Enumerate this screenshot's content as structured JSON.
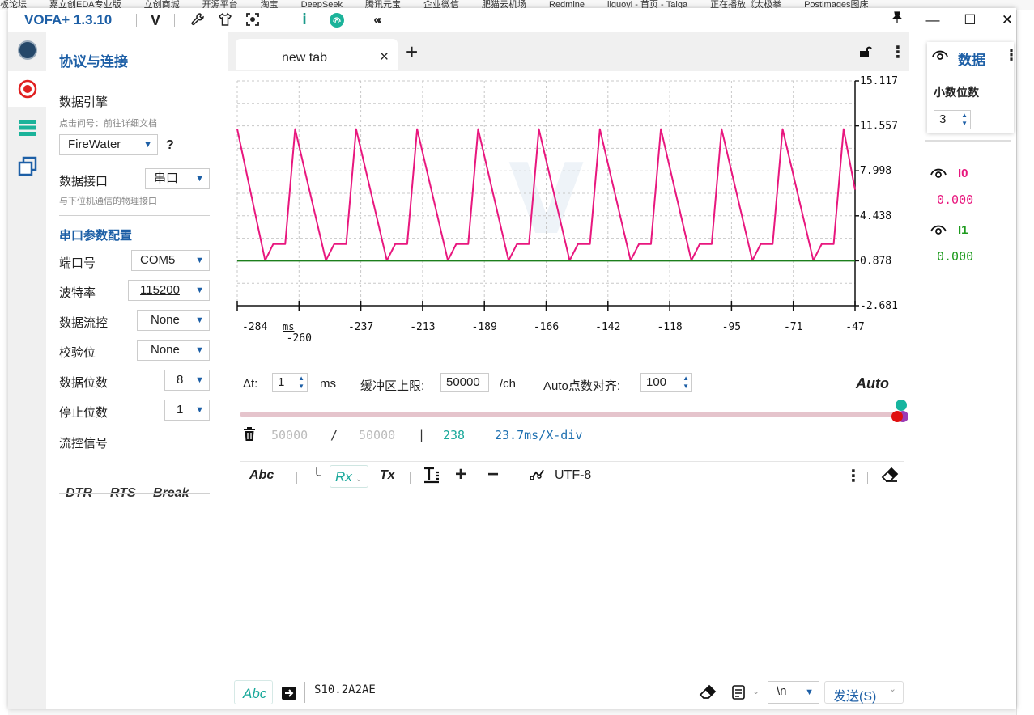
{
  "browser": {
    "bookmarks": [
      "板论坛",
      "嘉立创EDA专业版",
      "立创商城",
      "开源平台",
      "淘宝",
      "DeepSeek",
      "腾讯元宝",
      "企业微信",
      "肥猫云机场",
      "Redmine",
      "liguoyi - 首页 - Taiga",
      "正在播放《太极拳",
      "Postimages图床"
    ]
  },
  "app": {
    "title": "VOFA+ 1.3.10"
  },
  "rail": {
    "items": [
      "connection",
      "protocol",
      "data",
      "widgets"
    ]
  },
  "left": {
    "heading": "协议与连接",
    "engine_label": "数据引擎",
    "engine_hint": "点击问号：前往详细文档",
    "engine_value": "FireWater",
    "help": "?",
    "iface_label": "数据接口",
    "iface_value": "串口",
    "iface_hint": "与下位机通信的物理接口",
    "serial_heading": "串口参数配置",
    "port_label": "端口号",
    "port_value": "COM5",
    "baud_label": "波特率",
    "baud_value": "115200",
    "flow_label": "数据流控",
    "flow_value": "None",
    "parity_label": "校验位",
    "parity_value": "None",
    "databits_label": "数据位数",
    "databits_value": "8",
    "stopbits_label": "停止位数",
    "stopbits_value": "1",
    "signal_label": "流控信号",
    "dtr": "DTR",
    "rts": "RTS",
    "brk": "Break"
  },
  "tabs": {
    "tab1": "new tab",
    "close": "×",
    "add": "+"
  },
  "chart_data": {
    "type": "line",
    "xlabel": "ms",
    "x_ticks": [
      "-284",
      "-260",
      "-237",
      "-213",
      "-189",
      "-166",
      "-142",
      "-118",
      "-95",
      "-71",
      "-47"
    ],
    "y_ticks": [
      "15.117",
      "11.557",
      "7.998",
      "4.438",
      "0.878",
      "-2.681"
    ],
    "xlim": [
      -284,
      -47
    ],
    "ylim": [
      -2.681,
      15.117
    ],
    "series": [
      {
        "name": "I0",
        "color": "#e8177e",
        "x": [
          -284,
          -273.3,
          -270.2,
          -265.6,
          -261.8,
          -250.0,
          -246.8,
          -242.2,
          -238.4,
          -226.6,
          -223.4,
          -218.8,
          -215.0,
          -203.2,
          -200.0,
          -195.4,
          -191.6,
          -179.9,
          -176.7,
          -172.1,
          -168.3,
          -156.5,
          -153.3,
          -148.7,
          -144.9,
          -133.1,
          -129.9,
          -125.3,
          -121.5,
          -109.8,
          -106.6,
          -102.0,
          -98.2,
          -86.4,
          -83.2,
          -78.6,
          -74.8,
          -63.0,
          -59.8,
          -55.2,
          -51.4,
          -47
        ],
        "y": [
          11.3,
          0.9,
          2.2,
          2.2,
          11.3,
          0.9,
          2.2,
          2.2,
          11.3,
          0.9,
          2.2,
          2.2,
          11.3,
          0.9,
          2.2,
          2.2,
          11.3,
          0.9,
          2.2,
          2.2,
          11.3,
          0.9,
          2.2,
          2.2,
          11.3,
          0.9,
          2.2,
          2.2,
          11.3,
          0.9,
          2.2,
          2.2,
          11.3,
          0.9,
          2.2,
          2.2,
          11.3,
          0.9,
          2.2,
          2.2,
          11.3,
          6.5
        ]
      },
      {
        "name": "I1",
        "color": "#1d7f1d",
        "x": [
          -284,
          -47
        ],
        "y": [
          0.878,
          0.878
        ]
      }
    ]
  },
  "controls": {
    "dt_label": "Δt:",
    "dt_value": "1",
    "dt_unit": "ms",
    "buffer_label": "缓冲区上限:",
    "buffer_value": "50000",
    "buffer_unit": "/ch",
    "auto_align_label": "Auto点数对齐:",
    "auto_align_value": "100",
    "auto": "Auto"
  },
  "stats": {
    "a": "50000",
    "slash": "/",
    "b": "50000",
    "bar": "|",
    "count": "238",
    "rate": "23.7ms/X-div"
  },
  "toolbar2": {
    "abc": "Abc",
    "rx": "Rx",
    "tx": "Tx",
    "encoding": "UTF-8"
  },
  "send": {
    "abc": "Abc",
    "input": "S10.2A2AE",
    "newline": "\\n",
    "send_label": "发送(S)"
  },
  "right": {
    "title": "数据",
    "decimals_label": "小数位数",
    "decimals_value": "3",
    "channels": [
      {
        "name": "I0",
        "value": "0.000",
        "color": "#e8177e"
      },
      {
        "name": "I1",
        "value": "0.000",
        "color": "#1d9a1d"
      }
    ]
  }
}
